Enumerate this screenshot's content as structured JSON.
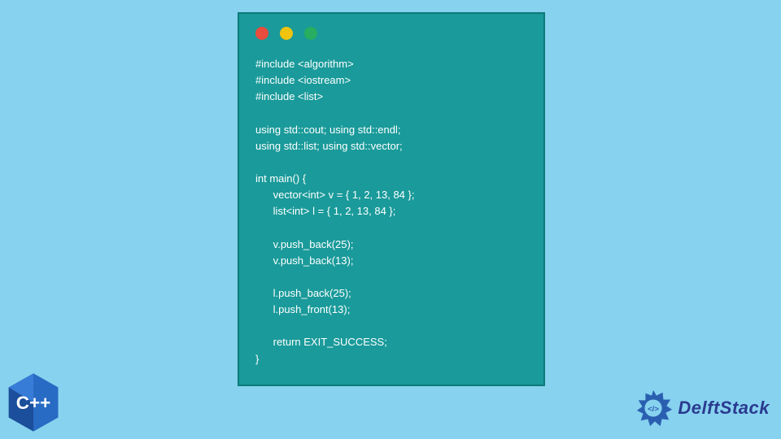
{
  "code": {
    "lines": [
      "#include <algorithm>",
      "#include <iostream>",
      "#include <list>",
      "",
      "using std::cout; using std::endl;",
      "using std::list; using std::vector;",
      "",
      "int main() {",
      "      vector<int> v = { 1, 2, 13, 84 };",
      "      list<int> l = { 1, 2, 13, 84 };",
      "",
      "      v.push_back(25);",
      "      v.push_back(13);",
      "",
      "      l.push_back(25);",
      "      l.push_front(13);",
      "",
      "      return EXIT_SUCCESS;",
      "}"
    ]
  },
  "traffic": {
    "red": "#e74c3c",
    "yellow": "#f1c40f",
    "green": "#27ae60"
  },
  "cpp_badge": {
    "label": "C++",
    "color": "#1b4e9b"
  },
  "brand": {
    "name": "DelftStack",
    "icon_color": "#2a5fb0"
  }
}
